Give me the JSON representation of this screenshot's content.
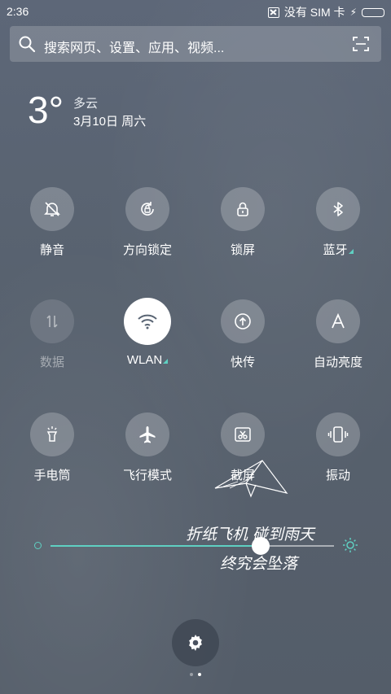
{
  "status_bar": {
    "time": "2:36",
    "carrier": "没有 SIM 卡",
    "battery_level": 1.0,
    "battery_color": "#57d13a",
    "icons": [
      "sim-card-icon",
      "charging-bolt-icon",
      "battery-icon"
    ]
  },
  "search": {
    "placeholder": "搜索网页、设置、应用、视频...",
    "icons": [
      "search-icon",
      "scan-icon"
    ]
  },
  "weather": {
    "temperature": "3°",
    "condition": "多云",
    "date": "3月10日 周六"
  },
  "tiles": [
    {
      "label": "静音",
      "icon": "bell-off-icon",
      "state": "off"
    },
    {
      "label": "方向锁定",
      "icon": "rotation-lock-icon",
      "state": "off"
    },
    {
      "label": "锁屏",
      "icon": "lock-icon",
      "state": "off"
    },
    {
      "label": "蓝牙",
      "icon": "bluetooth-icon",
      "state": "off",
      "expandable": true
    },
    {
      "label": "数据",
      "icon": "mobile-data-icon",
      "state": "disabled"
    },
    {
      "label": "WLAN",
      "icon": "wifi-icon",
      "state": "on",
      "expandable": true
    },
    {
      "label": "快传",
      "icon": "fast-share-icon",
      "state": "off"
    },
    {
      "label": "自动亮度",
      "icon": "auto-brightness-icon",
      "state": "off"
    },
    {
      "label": "手电筒",
      "icon": "flashlight-icon",
      "state": "off"
    },
    {
      "label": "飞行模式",
      "icon": "airplane-icon",
      "state": "off"
    },
    {
      "label": "截屏",
      "icon": "screenshot-icon",
      "state": "off"
    },
    {
      "label": "振动",
      "icon": "vibrate-icon",
      "state": "off"
    }
  ],
  "brightness": {
    "level": 0.74,
    "accent": "#5fd0c2",
    "icons": [
      "brightness-low-icon",
      "brightness-high-icon"
    ]
  },
  "wallpaper_text": {
    "line1": "折纸飞机 碰到雨天",
    "line2": "终究会坠落"
  },
  "settings_button": {
    "icon": "gear-icon"
  },
  "page_indicator": {
    "count": 2,
    "active": 2
  }
}
